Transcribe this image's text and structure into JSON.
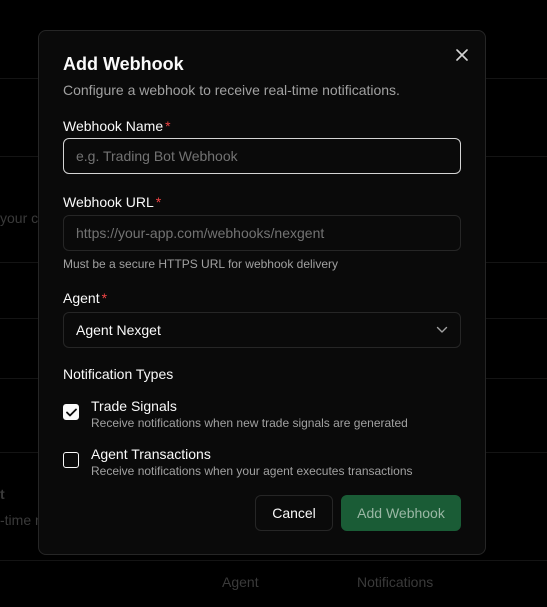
{
  "background": {
    "text_left_1": "your c",
    "text_left_2": "t",
    "text_left_3": "-time n",
    "col_agent": "Agent",
    "col_notifications": "Notifications"
  },
  "modal": {
    "title": "Add Webhook",
    "subtitle": "Configure a webhook to receive real-time notifications.",
    "close_icon": "close-icon",
    "name_field": {
      "label": "Webhook Name",
      "required_mark": "*",
      "value": "",
      "placeholder": "e.g. Trading Bot Webhook"
    },
    "url_field": {
      "label": "Webhook URL",
      "required_mark": "*",
      "value": "",
      "placeholder": "https://your-app.com/webhooks/nexgent",
      "help": "Must be a secure HTTPS URL for webhook delivery"
    },
    "agent_field": {
      "label": "Agent",
      "required_mark": "*",
      "selected": "Agent Nexget",
      "icon": "chevron-down-icon"
    },
    "notification_types": {
      "title": "Notification Types",
      "items": [
        {
          "label": "Trade Signals",
          "description": "Receive notifications when new trade signals are generated",
          "checked": true
        },
        {
          "label": "Agent Transactions",
          "description": "Receive notifications when your agent executes transactions",
          "checked": false
        }
      ]
    },
    "cancel_label": "Cancel",
    "submit_label": "Add Webhook"
  },
  "colors": {
    "accent": "#1a5c36",
    "required": "#ef4444",
    "surface": "#0a0a0a",
    "border": "#262626"
  }
}
